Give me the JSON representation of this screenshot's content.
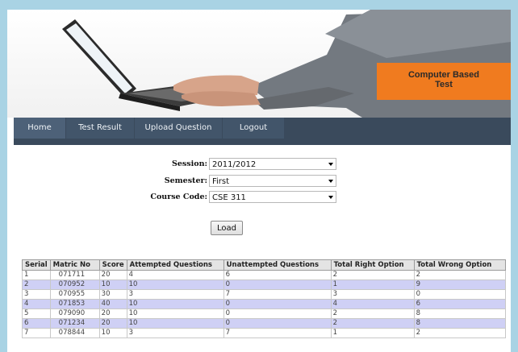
{
  "banner": {
    "brand_line1": "Computer Based",
    "brand_line2": "Test"
  },
  "nav": [
    {
      "label": "Home"
    },
    {
      "label": "Test Result"
    },
    {
      "label": "Upload Question"
    },
    {
      "label": "Logout"
    }
  ],
  "form": {
    "session_label": "Session:",
    "session_value": "2011/2012",
    "semester_label": "Semester:",
    "semester_value": "First",
    "course_label": "Course Code:",
    "course_value": "CSE 311",
    "load_label": "Load"
  },
  "table": {
    "headers": [
      "Serial",
      "Matric No",
      "Score",
      "Attempted Questions",
      "Unattempted Questions",
      "Total Right Option",
      "Total Wrong Option"
    ],
    "rows": [
      [
        "1",
        "071711",
        "20",
        "4",
        "6",
        "2",
        "2"
      ],
      [
        "2",
        "070952",
        "10",
        "10",
        "0",
        "1",
        "9"
      ],
      [
        "3",
        "070955",
        "30",
        "3",
        "7",
        "3",
        "0"
      ],
      [
        "4",
        "071853",
        "40",
        "10",
        "0",
        "4",
        "6"
      ],
      [
        "5",
        "079090",
        "20",
        "10",
        "0",
        "2",
        "8"
      ],
      [
        "6",
        "071234",
        "20",
        "10",
        "0",
        "2",
        "8"
      ],
      [
        "7",
        "078844",
        "10",
        "3",
        "7",
        "1",
        "2"
      ]
    ]
  }
}
